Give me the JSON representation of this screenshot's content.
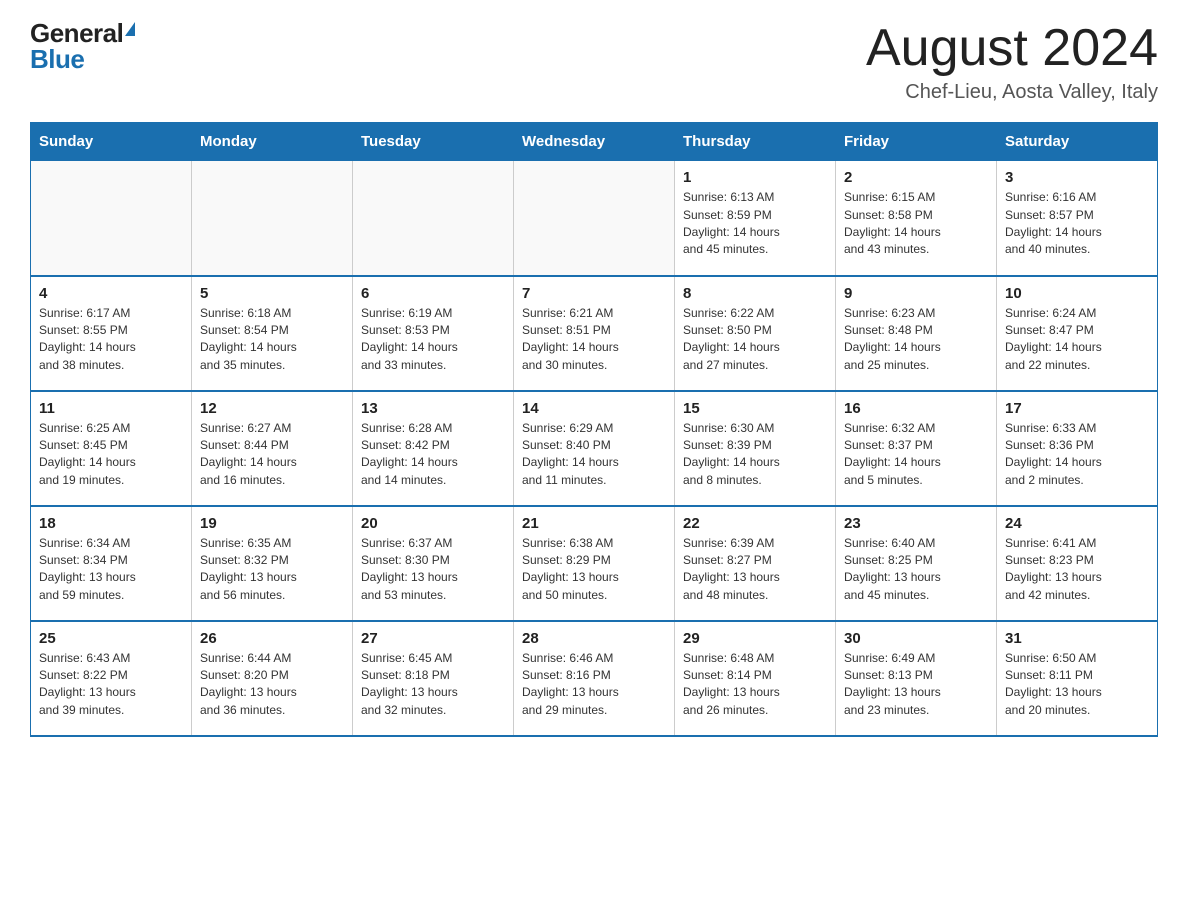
{
  "header": {
    "logo_general": "General",
    "logo_blue": "Blue",
    "title": "August 2024",
    "subtitle": "Chef-Lieu, Aosta Valley, Italy"
  },
  "columns": [
    "Sunday",
    "Monday",
    "Tuesday",
    "Wednesday",
    "Thursday",
    "Friday",
    "Saturday"
  ],
  "weeks": [
    [
      {
        "day": "",
        "info": ""
      },
      {
        "day": "",
        "info": ""
      },
      {
        "day": "",
        "info": ""
      },
      {
        "day": "",
        "info": ""
      },
      {
        "day": "1",
        "info": "Sunrise: 6:13 AM\nSunset: 8:59 PM\nDaylight: 14 hours\nand 45 minutes."
      },
      {
        "day": "2",
        "info": "Sunrise: 6:15 AM\nSunset: 8:58 PM\nDaylight: 14 hours\nand 43 minutes."
      },
      {
        "day": "3",
        "info": "Sunrise: 6:16 AM\nSunset: 8:57 PM\nDaylight: 14 hours\nand 40 minutes."
      }
    ],
    [
      {
        "day": "4",
        "info": "Sunrise: 6:17 AM\nSunset: 8:55 PM\nDaylight: 14 hours\nand 38 minutes."
      },
      {
        "day": "5",
        "info": "Sunrise: 6:18 AM\nSunset: 8:54 PM\nDaylight: 14 hours\nand 35 minutes."
      },
      {
        "day": "6",
        "info": "Sunrise: 6:19 AM\nSunset: 8:53 PM\nDaylight: 14 hours\nand 33 minutes."
      },
      {
        "day": "7",
        "info": "Sunrise: 6:21 AM\nSunset: 8:51 PM\nDaylight: 14 hours\nand 30 minutes."
      },
      {
        "day": "8",
        "info": "Sunrise: 6:22 AM\nSunset: 8:50 PM\nDaylight: 14 hours\nand 27 minutes."
      },
      {
        "day": "9",
        "info": "Sunrise: 6:23 AM\nSunset: 8:48 PM\nDaylight: 14 hours\nand 25 minutes."
      },
      {
        "day": "10",
        "info": "Sunrise: 6:24 AM\nSunset: 8:47 PM\nDaylight: 14 hours\nand 22 minutes."
      }
    ],
    [
      {
        "day": "11",
        "info": "Sunrise: 6:25 AM\nSunset: 8:45 PM\nDaylight: 14 hours\nand 19 minutes."
      },
      {
        "day": "12",
        "info": "Sunrise: 6:27 AM\nSunset: 8:44 PM\nDaylight: 14 hours\nand 16 minutes."
      },
      {
        "day": "13",
        "info": "Sunrise: 6:28 AM\nSunset: 8:42 PM\nDaylight: 14 hours\nand 14 minutes."
      },
      {
        "day": "14",
        "info": "Sunrise: 6:29 AM\nSunset: 8:40 PM\nDaylight: 14 hours\nand 11 minutes."
      },
      {
        "day": "15",
        "info": "Sunrise: 6:30 AM\nSunset: 8:39 PM\nDaylight: 14 hours\nand 8 minutes."
      },
      {
        "day": "16",
        "info": "Sunrise: 6:32 AM\nSunset: 8:37 PM\nDaylight: 14 hours\nand 5 minutes."
      },
      {
        "day": "17",
        "info": "Sunrise: 6:33 AM\nSunset: 8:36 PM\nDaylight: 14 hours\nand 2 minutes."
      }
    ],
    [
      {
        "day": "18",
        "info": "Sunrise: 6:34 AM\nSunset: 8:34 PM\nDaylight: 13 hours\nand 59 minutes."
      },
      {
        "day": "19",
        "info": "Sunrise: 6:35 AM\nSunset: 8:32 PM\nDaylight: 13 hours\nand 56 minutes."
      },
      {
        "day": "20",
        "info": "Sunrise: 6:37 AM\nSunset: 8:30 PM\nDaylight: 13 hours\nand 53 minutes."
      },
      {
        "day": "21",
        "info": "Sunrise: 6:38 AM\nSunset: 8:29 PM\nDaylight: 13 hours\nand 50 minutes."
      },
      {
        "day": "22",
        "info": "Sunrise: 6:39 AM\nSunset: 8:27 PM\nDaylight: 13 hours\nand 48 minutes."
      },
      {
        "day": "23",
        "info": "Sunrise: 6:40 AM\nSunset: 8:25 PM\nDaylight: 13 hours\nand 45 minutes."
      },
      {
        "day": "24",
        "info": "Sunrise: 6:41 AM\nSunset: 8:23 PM\nDaylight: 13 hours\nand 42 minutes."
      }
    ],
    [
      {
        "day": "25",
        "info": "Sunrise: 6:43 AM\nSunset: 8:22 PM\nDaylight: 13 hours\nand 39 minutes."
      },
      {
        "day": "26",
        "info": "Sunrise: 6:44 AM\nSunset: 8:20 PM\nDaylight: 13 hours\nand 36 minutes."
      },
      {
        "day": "27",
        "info": "Sunrise: 6:45 AM\nSunset: 8:18 PM\nDaylight: 13 hours\nand 32 minutes."
      },
      {
        "day": "28",
        "info": "Sunrise: 6:46 AM\nSunset: 8:16 PM\nDaylight: 13 hours\nand 29 minutes."
      },
      {
        "day": "29",
        "info": "Sunrise: 6:48 AM\nSunset: 8:14 PM\nDaylight: 13 hours\nand 26 minutes."
      },
      {
        "day": "30",
        "info": "Sunrise: 6:49 AM\nSunset: 8:13 PM\nDaylight: 13 hours\nand 23 minutes."
      },
      {
        "day": "31",
        "info": "Sunrise: 6:50 AM\nSunset: 8:11 PM\nDaylight: 13 hours\nand 20 minutes."
      }
    ]
  ]
}
